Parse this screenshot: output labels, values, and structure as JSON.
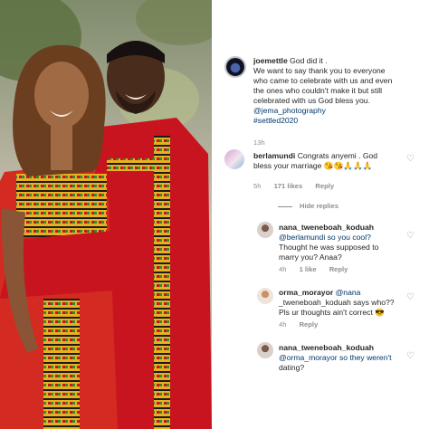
{
  "post": {
    "username": "joemettle",
    "caption_line1": "God did it .",
    "caption_lines": [
      "We want to say thank you to everyone",
      "who came to celebrate with us and even",
      "the ones who couldn't make it but still",
      "celebrated with us God bless you."
    ],
    "mention": "@jema_photography",
    "hashtag": "#settled2020",
    "time": "13h"
  },
  "comments": [
    {
      "username": "berlamundi",
      "lines": [
        "Congrats anyemi . God",
        "bless your marriage 😘😘🙏🙏🙏"
      ],
      "time": "5h",
      "likes": "171 likes",
      "reply": "Reply"
    }
  ],
  "hide_replies": "Hide replies",
  "replies": [
    {
      "username": "nana_tweneboah_koduah",
      "lines": [
        "@berlamundi so you cool?",
        "Thought he was supposed to",
        "marry you? Anaa?"
      ],
      "time": "4h",
      "likes": "1 like",
      "reply": "Reply"
    },
    {
      "username": "orma_morayor",
      "lines": [
        "@nana",
        "_tweneboah_koduah says who??",
        "Pls ur thoughts ain't correct 😎"
      ],
      "time": "4h",
      "reply": "Reply"
    },
    {
      "username": "nana_tweneboah_koduah",
      "lines": [
        "@orma_morayor so they weren't",
        "dating?"
      ]
    }
  ],
  "icons": {
    "heart": "heart-icon"
  }
}
